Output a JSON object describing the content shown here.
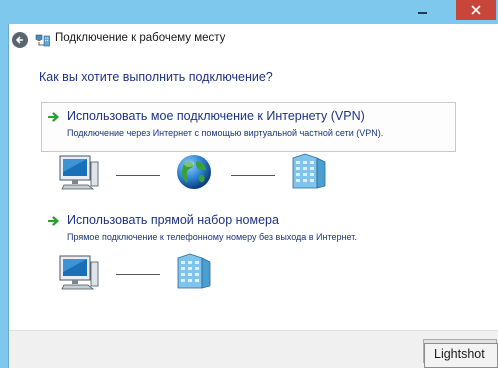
{
  "window": {
    "title": "Подключение к рабочему месту"
  },
  "content": {
    "question": "Как вы хотите выполнить подключение?",
    "options": [
      {
        "title": "Использовать мое подключение к Интернету (VPN)",
        "description": "Подключение через Интернет с помощью виртуальной частной сети (VPN)."
      },
      {
        "title": "Использовать прямой набор номера",
        "description": "Прямое подключение к телефонному номеру без выхода в Интернет."
      }
    ]
  },
  "tooltip": {
    "text": "Lightshot"
  },
  "icons": {
    "back": "back-arrow-icon",
    "nav": "network-connection-icon",
    "option_arrow": "green-arrow-icon",
    "computer": "computer-icon",
    "globe": "globe-icon",
    "server": "server-building-icon"
  },
  "colors": {
    "window_frame": "#7ec8ee",
    "close_button": "#c7453a",
    "link_text": "#1e3287",
    "option_border": "#c9c9c9",
    "arrow_green": "#2e9e2e"
  }
}
